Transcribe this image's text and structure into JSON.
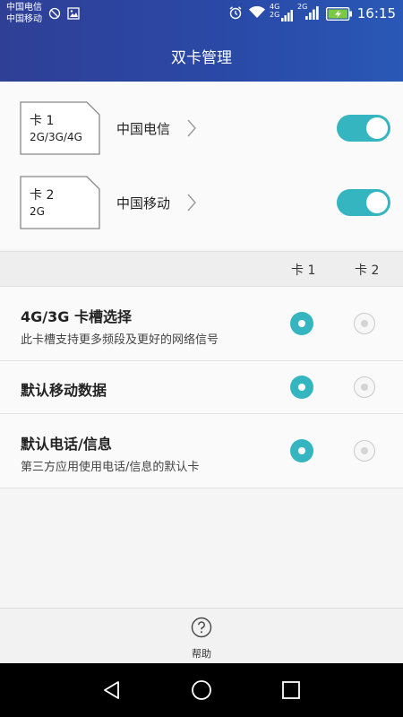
{
  "status_bar": {
    "carrier_1": "中国电信",
    "carrier_2": "中国移动",
    "net_top": "4G",
    "net_bottom": "2G",
    "net_2": "2G",
    "time": "16:15"
  },
  "header": {
    "title": "双卡管理"
  },
  "sims": [
    {
      "name": "卡 1",
      "networks": "2G/3G/4G",
      "operator": "中国电信",
      "enabled": true
    },
    {
      "name": "卡 2",
      "networks": "2G",
      "operator": "中国移动",
      "enabled": true
    }
  ],
  "columns": {
    "card1": "卡 1",
    "card2": "卡 2"
  },
  "options": [
    {
      "title": "4G/3G 卡槽选择",
      "subtitle": "此卡槽支持更多频段及更好的网络信号",
      "selected": "card1"
    },
    {
      "title": "默认移动数据",
      "subtitle": "",
      "selected": "card1"
    },
    {
      "title": "默认电话/信息",
      "subtitle": "第三方应用使用电话/信息的默认卡",
      "selected": "card1"
    }
  ],
  "help": {
    "label": "帮助"
  },
  "colors": {
    "accent": "#35b5c0",
    "header": "#2f4aa4"
  }
}
